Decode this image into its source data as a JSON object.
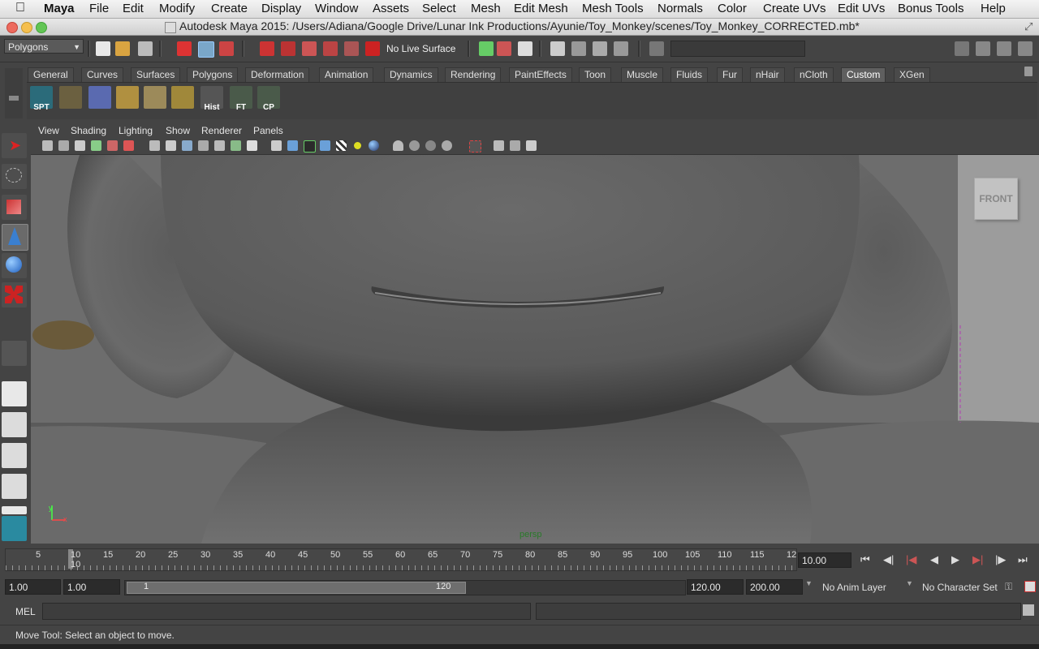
{
  "menubar": {
    "app": "Maya",
    "items": [
      "File",
      "Edit",
      "Modify",
      "Create",
      "Display",
      "Window",
      "Assets",
      "Select",
      "Mesh",
      "Edit Mesh",
      "Mesh Tools",
      "Normals",
      "Color",
      "Create UVs",
      "Edit UVs",
      "Bonus Tools",
      "Help"
    ]
  },
  "window": {
    "title": "Autodesk Maya 2015: /Users/Adiana/Google Drive/Lunar Ink Productions/Ayunie/Toy_Monkey/scenes/Toy_Monkey_CORRECTED.mb*"
  },
  "statusline": {
    "menuset": "Polygons",
    "live_surface": "No Live Surface"
  },
  "shelf": {
    "tabs": [
      "General",
      "Curves",
      "Surfaces",
      "Polygons",
      "Deformation",
      "Animation",
      "Dynamics",
      "Rendering",
      "PaintEffects",
      "Toon",
      "Muscle",
      "Fluids",
      "Fur",
      "nHair",
      "nCloth",
      "Custom",
      "XGen"
    ],
    "active_tab": "Custom",
    "buttons": [
      {
        "label": "SPT"
      },
      {
        "label": ""
      },
      {
        "label": ""
      },
      {
        "label": ""
      },
      {
        "label": ""
      },
      {
        "label": ""
      },
      {
        "label": "Hist"
      },
      {
        "label": "FT"
      },
      {
        "label": "CP"
      }
    ]
  },
  "panel": {
    "menus": [
      "View",
      "Shading",
      "Lighting",
      "Show",
      "Renderer",
      "Panels"
    ],
    "camera_label": "persp",
    "viewcube_label": "FRONT"
  },
  "timeslider": {
    "ticks": [
      "5",
      "10",
      "15",
      "20",
      "25",
      "30",
      "35",
      "40",
      "45",
      "50",
      "55",
      "60",
      "65",
      "70",
      "75",
      "80",
      "85",
      "90",
      "95",
      "100",
      "105",
      "110",
      "115",
      "12"
    ],
    "current_frame_marker": "10",
    "current_time": "10.00"
  },
  "range": {
    "start_time": "1.00",
    "playback_start": "1.00",
    "slider_start": "1",
    "slider_end": "120",
    "playback_end": "120.00",
    "end_time": "200.00",
    "anim_layer": "No Anim Layer",
    "character_set": "No Character Set"
  },
  "cmdline": {
    "label": "MEL"
  },
  "helpline": {
    "text": "Move Tool: Select an object to move."
  }
}
